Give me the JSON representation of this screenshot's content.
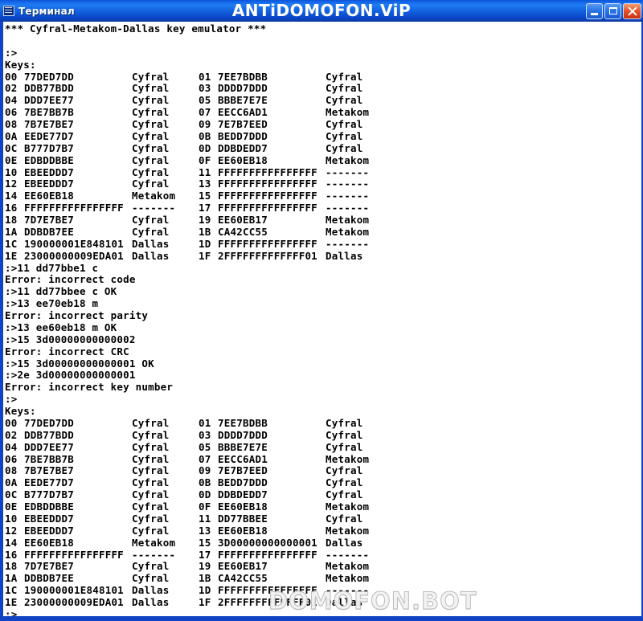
{
  "window": {
    "title": "Терминал",
    "brand": "ANTiDOMOFON.ViP",
    "icon": "terminal-icon",
    "controls": {
      "minimize_label": "Minimize",
      "maximize_label": "Maximize",
      "close_label": "Close"
    },
    "colors": {
      "titlebar_blue": "#1464e8",
      "border_blue": "#1144c4",
      "close_red": "#e8562c",
      "client_bg": "#ffffff",
      "text": "#000000",
      "watermark": "#f2f2f2"
    }
  },
  "watermark": "DOMOFON.BOT",
  "terminal": {
    "header": "*** Cyfral-Metakom-Dallas key emulator ***",
    "blank_after_header": "",
    "prompt": ":>",
    "keys_label": "Keys:",
    "key_list_1": [
      {
        "idx": "00",
        "value": "77DED7DD",
        "type": "Cyfral"
      },
      {
        "idx": "01",
        "value": "7EE7BDBB",
        "type": "Cyfral"
      },
      {
        "idx": "02",
        "value": "DDB77BDD",
        "type": "Cyfral"
      },
      {
        "idx": "03",
        "value": "DDDD7DDD",
        "type": "Cyfral"
      },
      {
        "idx": "04",
        "value": "DDD7EE77",
        "type": "Cyfral"
      },
      {
        "idx": "05",
        "value": "BBBE7E7E",
        "type": "Cyfral"
      },
      {
        "idx": "06",
        "value": "7BE7BB7B",
        "type": "Cyfral"
      },
      {
        "idx": "07",
        "value": "EECC6AD1",
        "type": "Metakom"
      },
      {
        "idx": "08",
        "value": "7B7E7BE7",
        "type": "Cyfral"
      },
      {
        "idx": "09",
        "value": "7E7B7EED",
        "type": "Cyfral"
      },
      {
        "idx": "0A",
        "value": "EEDE77D7",
        "type": "Cyfral"
      },
      {
        "idx": "0B",
        "value": "BEDD7DDD",
        "type": "Cyfral"
      },
      {
        "idx": "0C",
        "value": "B777D7B7",
        "type": "Cyfral"
      },
      {
        "idx": "0D",
        "value": "DDBDEDD7",
        "type": "Cyfral"
      },
      {
        "idx": "0E",
        "value": "EDBDDBBE",
        "type": "Cyfral"
      },
      {
        "idx": "0F",
        "value": "EE60EB18",
        "type": "Metakom"
      },
      {
        "idx": "10",
        "value": "EBEEDDD7",
        "type": "Cyfral"
      },
      {
        "idx": "11",
        "value": "FFFFFFFFFFFFFFFF",
        "type": "-------"
      },
      {
        "idx": "12",
        "value": "EBEEDDD7",
        "type": "Cyfral"
      },
      {
        "idx": "13",
        "value": "FFFFFFFFFFFFFFFF",
        "type": "-------"
      },
      {
        "idx": "14",
        "value": "EE60EB18",
        "type": "Metakom"
      },
      {
        "idx": "15",
        "value": "FFFFFFFFFFFFFFFF",
        "type": "-------"
      },
      {
        "idx": "16",
        "value": "FFFFFFFFFFFFFFFF",
        "type": "-------"
      },
      {
        "idx": "17",
        "value": "FFFFFFFFFFFFFFFF",
        "type": "-------"
      },
      {
        "idx": "18",
        "value": "7D7E7BE7",
        "type": "Cyfral"
      },
      {
        "idx": "19",
        "value": "EE60EB17",
        "type": "Metakom"
      },
      {
        "idx": "1A",
        "value": "DDBDB7EE",
        "type": "Cyfral"
      },
      {
        "idx": "1B",
        "value": "CA42CC55",
        "type": "Metakom"
      },
      {
        "idx": "1C",
        "value": "190000001E848101",
        "type": "Dallas"
      },
      {
        "idx": "1D",
        "value": "FFFFFFFFFFFFFFFF",
        "type": "-------"
      },
      {
        "idx": "1E",
        "value": "23000000009EDA01",
        "type": "Dallas"
      },
      {
        "idx": "1F",
        "value": "2FFFFFFFFFFFFF01",
        "type": "Dallas"
      }
    ],
    "session": [
      {
        "kind": "command",
        "text": ":>11 dd77bbe1 c"
      },
      {
        "kind": "error",
        "text": "Error: incorrect code"
      },
      {
        "kind": "command",
        "text": ":>11 dd77bbee c OK"
      },
      {
        "kind": "command",
        "text": ":>13 ee70eb18 m"
      },
      {
        "kind": "error",
        "text": "Error: incorrect parity"
      },
      {
        "kind": "command",
        "text": ":>13 ee60eb18 m OK"
      },
      {
        "kind": "command",
        "text": ":>15 3d00000000000002"
      },
      {
        "kind": "error",
        "text": "Error: incorrect CRC"
      },
      {
        "kind": "command",
        "text": ":>15 3d00000000000001 OK"
      },
      {
        "kind": "command",
        "text": ":>2e 3d00000000000001"
      },
      {
        "kind": "error",
        "text": "Error: incorrect key number"
      },
      {
        "kind": "command",
        "text": ":>"
      }
    ],
    "key_list_2": [
      {
        "idx": "00",
        "value": "77DED7DD",
        "type": "Cyfral"
      },
      {
        "idx": "01",
        "value": "7EE7BDBB",
        "type": "Cyfral"
      },
      {
        "idx": "02",
        "value": "DDB77BDD",
        "type": "Cyfral"
      },
      {
        "idx": "03",
        "value": "DDDD7DDD",
        "type": "Cyfral"
      },
      {
        "idx": "04",
        "value": "DDD7EE77",
        "type": "Cyfral"
      },
      {
        "idx": "05",
        "value": "BBBE7E7E",
        "type": "Cyfral"
      },
      {
        "idx": "06",
        "value": "7BE7BB7B",
        "type": "Cyfral"
      },
      {
        "idx": "07",
        "value": "EECC6AD1",
        "type": "Metakom"
      },
      {
        "idx": "08",
        "value": "7B7E7BE7",
        "type": "Cyfral"
      },
      {
        "idx": "09",
        "value": "7E7B7EED",
        "type": "Cyfral"
      },
      {
        "idx": "0A",
        "value": "EEDE77D7",
        "type": "Cyfral"
      },
      {
        "idx": "0B",
        "value": "BEDD7DDD",
        "type": "Cyfral"
      },
      {
        "idx": "0C",
        "value": "B777D7B7",
        "type": "Cyfral"
      },
      {
        "idx": "0D",
        "value": "DDBDEDD7",
        "type": "Cyfral"
      },
      {
        "idx": "0E",
        "value": "EDBDDBBE",
        "type": "Cyfral"
      },
      {
        "idx": "0F",
        "value": "EE60EB18",
        "type": "Metakom"
      },
      {
        "idx": "10",
        "value": "EBEEDDD7",
        "type": "Cyfral"
      },
      {
        "idx": "11",
        "value": "DD77BBEE",
        "type": "Cyfral"
      },
      {
        "idx": "12",
        "value": "EBEEDDD7",
        "type": "Cyfral"
      },
      {
        "idx": "13",
        "value": "EE60EB18",
        "type": "Metakom"
      },
      {
        "idx": "14",
        "value": "EE60EB18",
        "type": "Metakom"
      },
      {
        "idx": "15",
        "value": "3D00000000000001",
        "type": "Dallas"
      },
      {
        "idx": "16",
        "value": "FFFFFFFFFFFFFFFF",
        "type": "-------"
      },
      {
        "idx": "17",
        "value": "FFFFFFFFFFFFFFFF",
        "type": "-------"
      },
      {
        "idx": "18",
        "value": "7D7E7BE7",
        "type": "Cyfral"
      },
      {
        "idx": "19",
        "value": "EE60EB17",
        "type": "Metakom"
      },
      {
        "idx": "1A",
        "value": "DDBDB7EE",
        "type": "Cyfral"
      },
      {
        "idx": "1B",
        "value": "CA42CC55",
        "type": "Metakom"
      },
      {
        "idx": "1C",
        "value": "190000001E848101",
        "type": "Dallas"
      },
      {
        "idx": "1D",
        "value": "FFFFFFFFFFFFFFFF",
        "type": "-------"
      },
      {
        "idx": "1E",
        "value": "23000000009EDA01",
        "type": "Dallas"
      },
      {
        "idx": "1F",
        "value": "2FFFFFFFFFFFFF01",
        "type": "Dallas"
      }
    ],
    "final_prompt": ":>"
  }
}
